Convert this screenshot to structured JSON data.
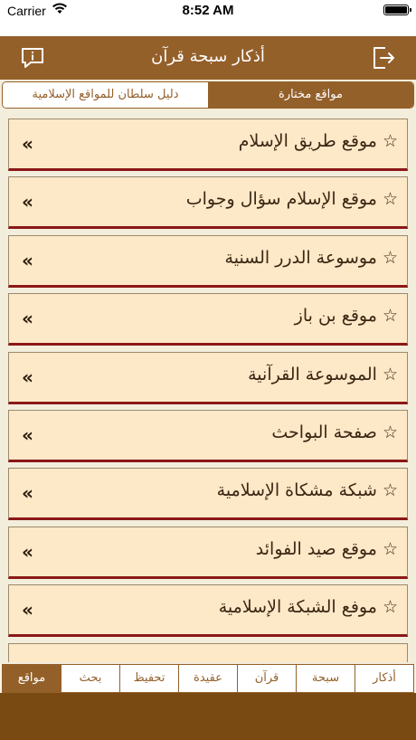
{
  "status": {
    "carrier": "Carrier",
    "time": "8:52 AM"
  },
  "header": {
    "title": "أذكار سبحة قرآن"
  },
  "segments": {
    "right": "مواقع مختارة",
    "left": "دليل سلطان للمواقع الإسلامية"
  },
  "list": {
    "chevron": "«",
    "items": [
      {
        "label": "☆ موقع طريق الإسلام"
      },
      {
        "label": "☆ موقع الإسلام سؤال وجواب"
      },
      {
        "label": "☆ موسوعة الدرر السنية"
      },
      {
        "label": "☆ موقع بن باز"
      },
      {
        "label": "☆ الموسوعة القرآنية"
      },
      {
        "label": "☆ صفحة البواحث"
      },
      {
        "label": "☆ شبكة مشكاة الإسلامية"
      },
      {
        "label": "☆ موقع صيد الفوائد"
      },
      {
        "label": "☆ موفع الشبكة الإسلامية"
      }
    ]
  },
  "tabs": [
    {
      "label": "أذكار"
    },
    {
      "label": "سبحة"
    },
    {
      "label": "قرآن"
    },
    {
      "label": "عقيدة"
    },
    {
      "label": "تحفيظ"
    },
    {
      "label": "بحث"
    },
    {
      "label": "مواقع"
    }
  ],
  "colors": {
    "brand": "#94602a",
    "rowBg": "#fde8c7",
    "rowAccent": "#8b1717"
  }
}
